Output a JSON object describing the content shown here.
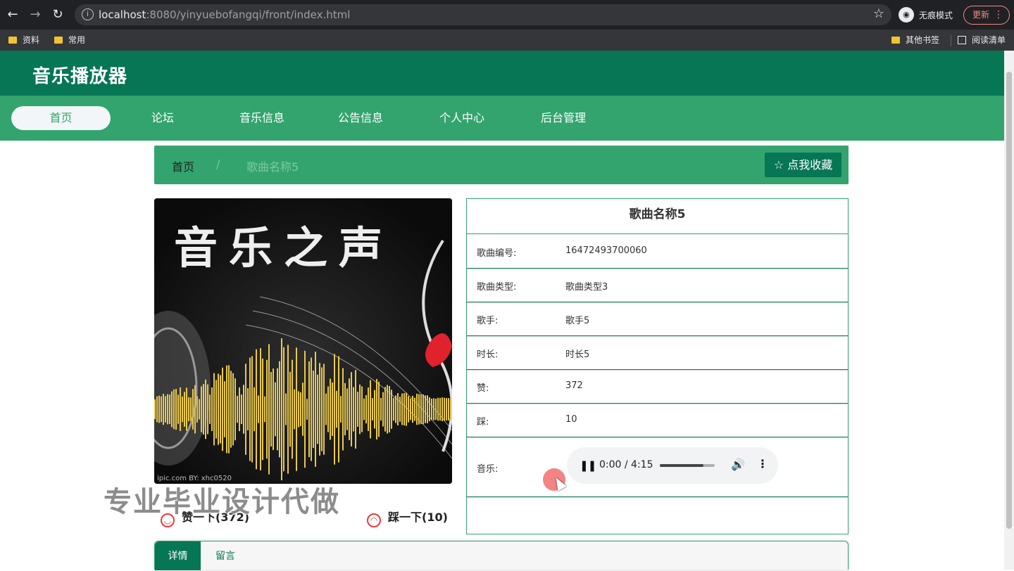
{
  "browser": {
    "url_host": "localhost",
    "url_rest": ":8080/yinyuebofangqi/front/index.html",
    "incognito_label": "无痕模式",
    "update_label": "更新",
    "bookmarks": [
      "资料",
      "常用"
    ],
    "bookmarks_right": [
      "其他书签",
      "阅读清单"
    ]
  },
  "site": {
    "title": "音乐播放器",
    "nav": [
      "首页",
      "论坛",
      "音乐信息",
      "公告信息",
      "个人中心",
      "后台管理"
    ]
  },
  "breadcrumb": {
    "home": "首页",
    "separator": "/",
    "current": "歌曲名称5",
    "favorite_label": "☆ 点我收藏"
  },
  "cover": {
    "title": "音乐之声",
    "credit": "ipic.com    BY: xhc0520"
  },
  "actions": {
    "like_label": "赞一下(372)",
    "dislike_label": "踩一下(10)"
  },
  "song": {
    "title": "歌曲名称5",
    "fields": [
      {
        "label": "歌曲编号:",
        "value": "16472493700060"
      },
      {
        "label": "歌曲类型:",
        "value": "歌曲类型3"
      },
      {
        "label": "歌手:",
        "value": "歌手5"
      },
      {
        "label": "时长:",
        "value": "时长5"
      },
      {
        "label": "赞:",
        "value": "372"
      },
      {
        "label": "踩:",
        "value": "10"
      }
    ],
    "music_label": "音乐:",
    "audio_time": "0:00 / 4:15",
    "audio_volume_level": 0.8
  },
  "watermark": "专业毕业设计代做",
  "tabs": [
    "详情",
    "留言"
  ],
  "colors": {
    "header_dark": "#067654",
    "nav_green": "#33a46e"
  }
}
